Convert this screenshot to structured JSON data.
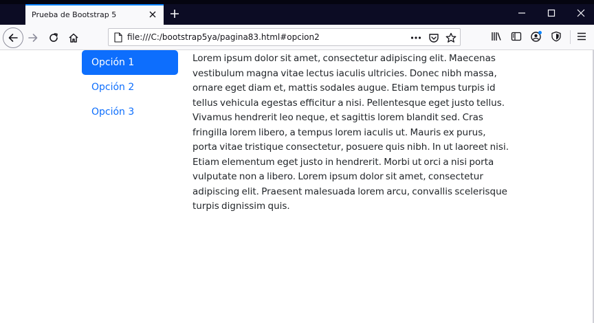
{
  "browser": {
    "tab_title": "Prueba de Bootstrap 5",
    "url": "file:///C:/bootstrap5ya/pagina83.html#opcion2",
    "icons": {
      "back": "back-arrow-icon",
      "forward": "forward-arrow-icon",
      "reload": "reload-icon",
      "home": "home-icon",
      "page_actions": "more-dots-icon",
      "pocket": "pocket-icon",
      "bookmark": "star-icon",
      "library": "library-icon",
      "sidebar": "sidebar-icon",
      "account": "account-icon",
      "shield": "shield-icon",
      "menu": "hamburger-menu-icon"
    }
  },
  "page": {
    "nav": {
      "items": [
        {
          "label": "Opción 1",
          "active": true
        },
        {
          "label": "Opción 2",
          "active": false
        },
        {
          "label": "Opción 3",
          "active": false
        }
      ]
    },
    "body_text": "Lorem ipsum dolor sit amet, consectetur adipiscing elit. Maecenas vestibulum magna vitae lectus iaculis ultricies. Donec nibh massa, ornare eget diam et, mattis sodales augue. Etiam tempus turpis id tellus vehicula egestas efficitur a nisi. Pellentesque eget justo tellus. Vivamus hendrerit leo neque, et sagittis lorem blandit sed. Cras fringilla lorem libero, a tempus lorem iaculis ut. Mauris ex purus, porta vitae tristique consectetur, posuere quis nibh. In ut laoreet nisi. Etiam elementum eget justo in hendrerit. Morbi ut orci a nisi porta vulputate non a libero. Lorem ipsum dolor sit amet, consectetur adipiscing elit. Praesent malesuada lorem arcu, convallis scelerisque turpis dignissim quis."
  },
  "colors": {
    "primary": "#0d6efd",
    "titlebar": "#0c0c24",
    "tab_accent": "#0a84ff"
  }
}
